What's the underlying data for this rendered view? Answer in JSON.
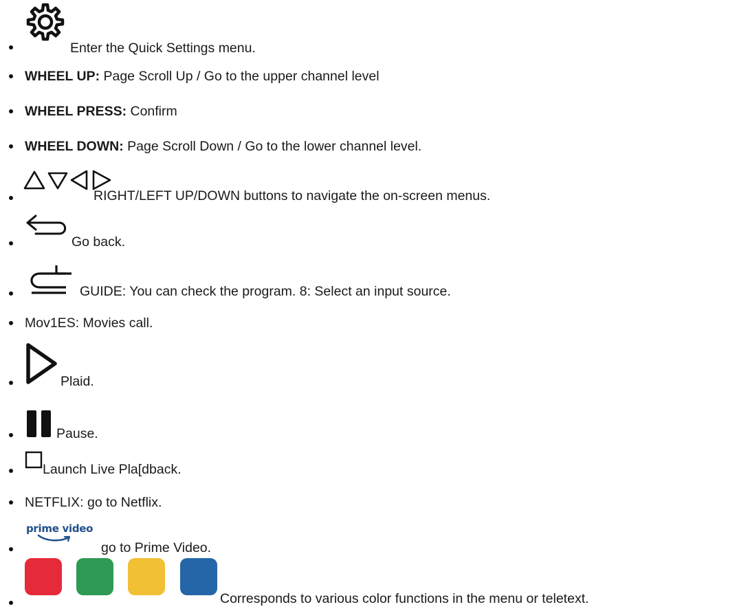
{
  "items": [
    {
      "icon": "gear-icon",
      "text": "Enter the Quick Settings menu."
    },
    {
      "bold": "WHEEL UP:",
      "text": " Page Scroll Up / Go to the upper channel level"
    },
    {
      "bold": "WHEEL PRESS:",
      "text": " Confirm"
    },
    {
      "bold": "WHEEL DOWN:",
      "text": " Page Scroll Down / Go to the lower channel level."
    },
    {
      "icon": "direction-arrows-icon",
      "text": "RIGHT/LEFT UP/DOWN buttons to navigate the on-screen menus."
    },
    {
      "icon": "back-arrow-icon",
      "text": "Go back."
    },
    {
      "icon": "input-source-icon",
      "text": "GUIDE: You can check the program. 8: Select an input source."
    },
    {
      "text": "Mov1ES: Movies call."
    },
    {
      "icon": "play-icon",
      "text": "Plaid."
    },
    {
      "icon": "pause-icon",
      "text": "Pause."
    },
    {
      "icon": "stop-icon",
      "text": "Launch Live Pla[dback."
    },
    {
      "text": "NETFLIX: go to Netflix."
    },
    {
      "icon": "prime-video-logo",
      "logo_text": "prime video",
      "text": "go to Prime Video."
    },
    {
      "icon": "color-buttons-icon",
      "text": "Corresponds to various color functions in the menu or teletext."
    }
  ],
  "colors": {
    "red": "#e52a3a",
    "green": "#2e9a55",
    "yellow": "#f2c035",
    "blue": "#2566a8",
    "text": "#1a1a1a",
    "prime_blue": "#1f4f8c"
  }
}
